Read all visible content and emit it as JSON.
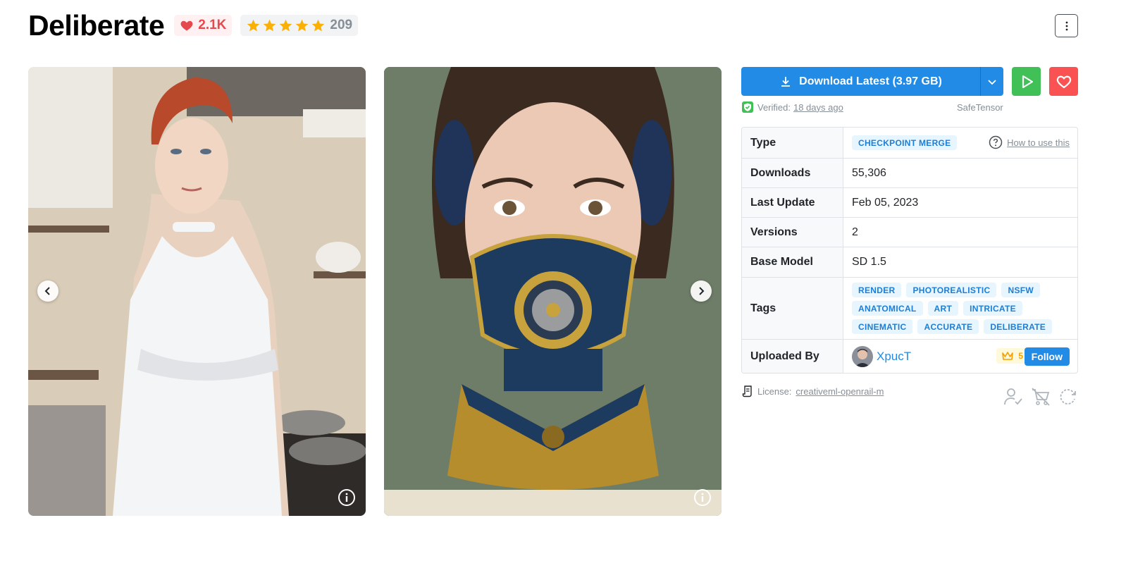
{
  "header": {
    "title": "Deliberate",
    "likes": "2.1K",
    "rating_count": "209",
    "stars": 5
  },
  "gallery": {
    "images": [
      {
        "subject": "woman-in-white-apron-in-kitchen"
      },
      {
        "subject": "woman-with-ornate-gold-face-mask"
      }
    ]
  },
  "actions": {
    "download_label": "Download Latest (3.97 GB)",
    "verified_label": "Verified:",
    "verified_ago": "18 days ago",
    "format": "SafeTensor"
  },
  "details": {
    "type_label": "Type",
    "type_value": "CHECKPOINT MERGE",
    "how_to": "How to use this",
    "downloads_label": "Downloads",
    "downloads_value": "55,306",
    "last_update_label": "Last Update",
    "last_update_value": "Feb 05, 2023",
    "versions_label": "Versions",
    "versions_value": "2",
    "base_model_label": "Base Model",
    "base_model_value": "SD 1.5",
    "tags_label": "Tags",
    "tags": [
      "RENDER",
      "PHOTOREALISTIC",
      "NSFW",
      "ANATOMICAL",
      "ART",
      "INTRICATE",
      "CINEMATIC",
      "ACCURATE",
      "DELIBERATE"
    ],
    "uploaded_by_label": "Uploaded By",
    "uploader": "XpucT",
    "uploader_rank": "5",
    "follow_label": "Follow"
  },
  "license": {
    "label": "License:",
    "name": "creativeml-openrail-m"
  },
  "colors": {
    "primary": "#228be6",
    "play": "#40c057",
    "favorite": "#fa5252",
    "like": "#e5484d",
    "star": "#fab005",
    "chip_bg": "#e7f5ff",
    "chip_text": "#1c7ed6"
  }
}
